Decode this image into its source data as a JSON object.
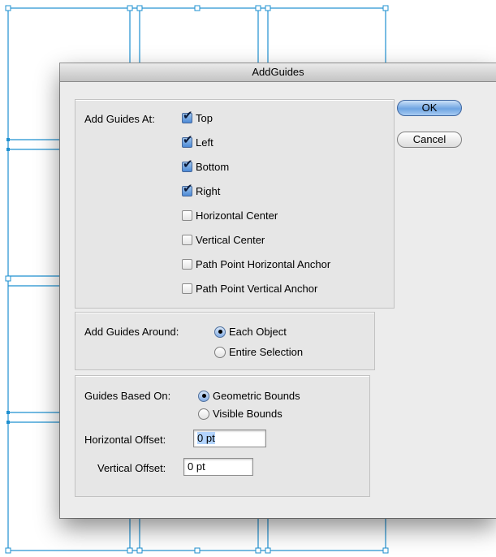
{
  "dialog": {
    "title": "AddGuides",
    "add_guides_at": {
      "label": "Add Guides At:",
      "options": [
        {
          "label": "Top",
          "checked": true
        },
        {
          "label": "Left",
          "checked": true
        },
        {
          "label": "Bottom",
          "checked": true
        },
        {
          "label": "Right",
          "checked": true
        },
        {
          "label": "Horizontal Center",
          "checked": false
        },
        {
          "label": "Vertical Center",
          "checked": false
        },
        {
          "label": "Path Point Horizontal Anchor",
          "checked": false
        },
        {
          "label": "Path Point Vertical Anchor",
          "checked": false
        }
      ]
    },
    "add_guides_around": {
      "label": "Add Guides Around:",
      "options": [
        {
          "label": "Each Object",
          "selected": true
        },
        {
          "label": "Entire Selection",
          "selected": false
        }
      ]
    },
    "guides_based_on": {
      "label": "Guides Based On:",
      "options": [
        {
          "label": "Geometric Bounds",
          "selected": true
        },
        {
          "label": "Visible Bounds",
          "selected": false
        }
      ]
    },
    "horizontal_offset": {
      "label": "Horizontal Offset:",
      "value": "0 pt"
    },
    "vertical_offset": {
      "label": "Vertical Offset:",
      "value": "0 pt"
    },
    "ok_label": "OK",
    "cancel_label": "Cancel"
  },
  "colors": {
    "guide": "#1e90d0",
    "default_button": "#6ea4e2",
    "selection_highlight": "#b3d4fd"
  }
}
